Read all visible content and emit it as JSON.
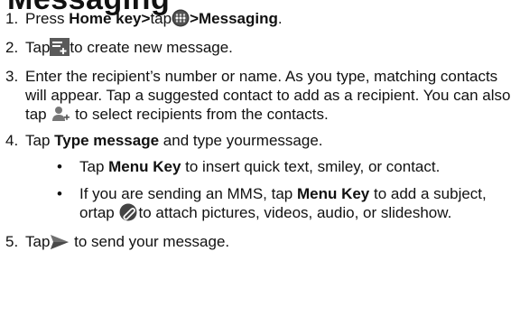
{
  "heading_partial": "Messaging",
  "steps": [
    {
      "number": "1.",
      "pre": "Press ",
      "bold1": "Home key>",
      "mid": "tap",
      "bold2": ">Messaging",
      "post": ".",
      "icon": "apps-icon"
    },
    {
      "number": "2.",
      "pre": "Tap",
      "post": "to create new message.",
      "icon": "new-message-icon"
    },
    {
      "number": "3.",
      "text": "Enter the recipient’s number or name. As you type, matching contacts will appear. Tap a suggested contact to add as a recipient. You can also tap ",
      "post": " to select recipients from the contacts.",
      "icon": "add-contact-icon"
    },
    {
      "number": "4.",
      "pre": "Tap ",
      "bold": "Type message",
      "post": " and type yourmessage.",
      "bullets": [
        {
          "dot": "•",
          "pre": "Tap ",
          "bold": "Menu Key",
          "post": " to insert quick text, smiley, or contact."
        },
        {
          "dot": "•",
          "pre": "If you are sending an MMS, tap ",
          "bold": "Menu Key",
          "mid": " to add a subject, ortap ",
          "post": "to attach pictures, videos, audio, or slideshow.",
          "icon": "attach-icon"
        }
      ]
    },
    {
      "number": "5.",
      "pre": "Tap",
      "post": " to send your message.",
      "icon": "send-icon"
    }
  ]
}
